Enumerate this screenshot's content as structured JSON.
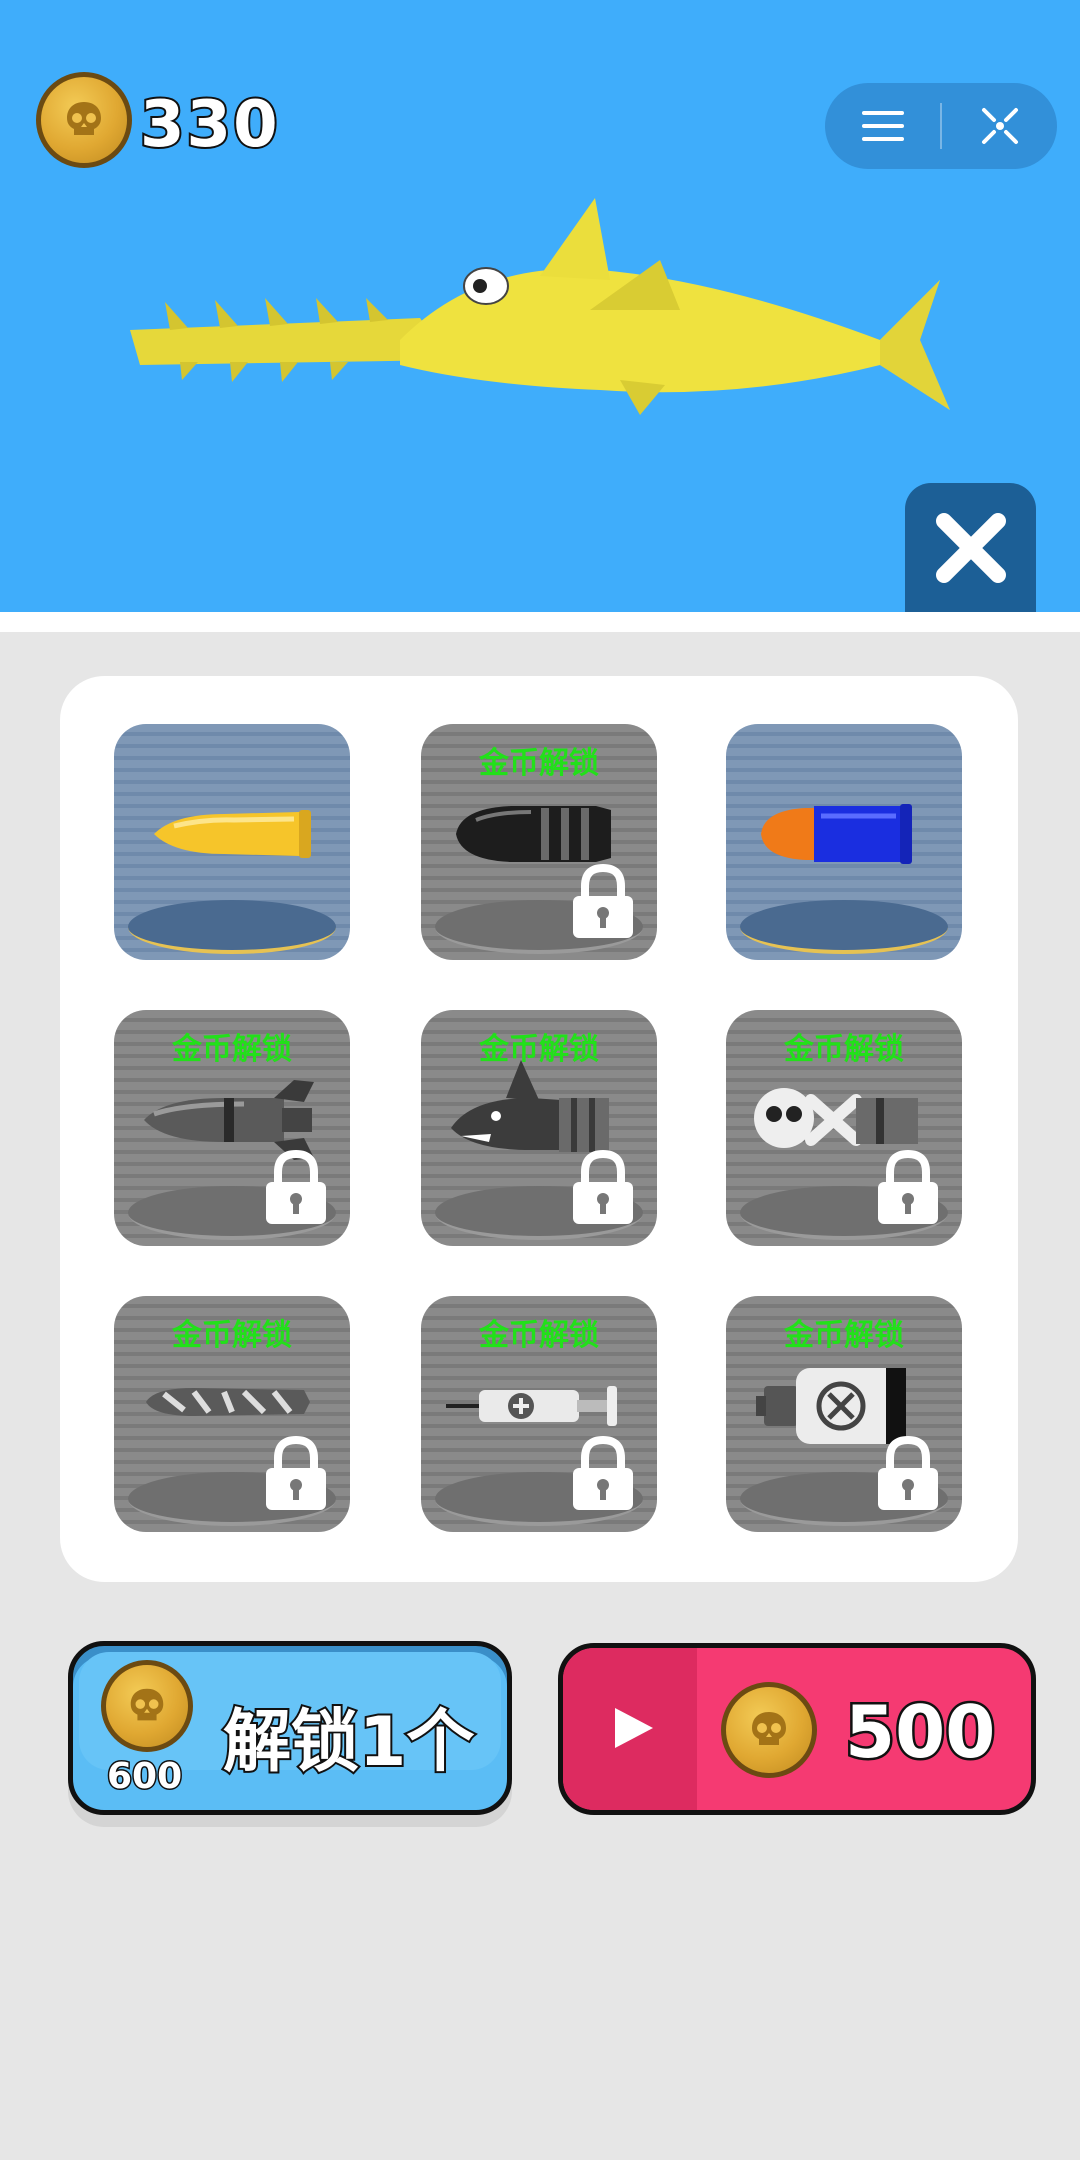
{
  "header": {
    "coin_count": "330",
    "coin_icon": "skull-coin-icon",
    "capsule": {
      "menu_icon": "menu-icon",
      "exit_icon": "target-exit-icon"
    },
    "scene_close_icon": "close-icon",
    "preview_model": "yellow-sawshark"
  },
  "grid": {
    "items": [
      {
        "model": "gold-bullet",
        "locked": false,
        "label": ""
      },
      {
        "model": "black-bullet",
        "locked": true,
        "label": "金币解锁"
      },
      {
        "model": "blue-orange-bullet",
        "locked": false,
        "label": ""
      },
      {
        "model": "rocket-bullet",
        "locked": true,
        "label": "金币解锁"
      },
      {
        "model": "shark-bullet",
        "locked": true,
        "label": "金币解锁"
      },
      {
        "model": "skull-bullet",
        "locked": true,
        "label": "金币解锁"
      },
      {
        "model": "graffiti-bullet",
        "locked": true,
        "label": "金币解锁"
      },
      {
        "model": "syringe-bullet",
        "locked": true,
        "label": "金币解锁"
      },
      {
        "model": "canister-bullet",
        "locked": true,
        "label": "金币解锁"
      }
    ]
  },
  "actions": {
    "unlock_label": "解锁1个",
    "unlock_price": "600",
    "video_reward": "500",
    "video_icon": "play-icon"
  },
  "colors": {
    "sky": "#3fadfb",
    "unlock_button": "#5bbdf5",
    "video_button": "#f53a72",
    "lock_label": "#22e01a"
  }
}
